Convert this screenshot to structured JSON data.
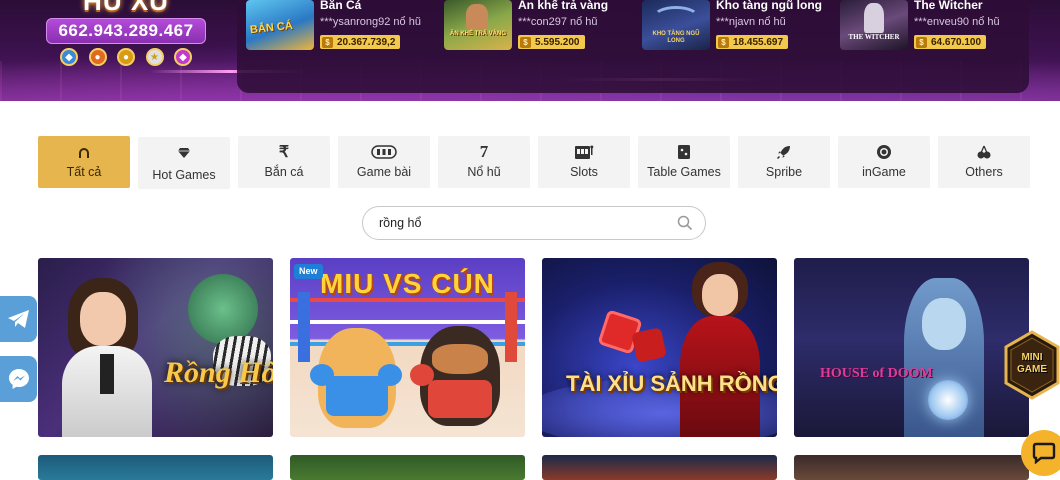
{
  "jackpot": {
    "title": "HŨ XU",
    "amount": "662.943.289.467"
  },
  "winners": [
    {
      "game": "Bắn Cá",
      "user": "***ysanrong92",
      "action": "nổ hũ",
      "amount": "20.367.739,2",
      "thumb_text": "BẮN CÁ"
    },
    {
      "game": "Ăn khế trả vàng",
      "user": "***con297",
      "action": "nổ hũ",
      "amount": "5.595.200",
      "thumb_text": "ĂN KHẾ TRẢ VÀNG"
    },
    {
      "game": "Kho tàng ngũ long",
      "user": "***njavn",
      "action": "nổ hũ",
      "amount": "18.455.697",
      "thumb_text": "KHO TÀNG NGŨ LONG"
    },
    {
      "game": "The Witcher",
      "user": "***enveu90",
      "action": "nổ hũ",
      "amount": "64.670.100",
      "thumb_text": "THE WITCHER"
    }
  ],
  "tabs": [
    {
      "label": "Tất cả",
      "icon": "horseshoe-icon",
      "active": true
    },
    {
      "label": "Hot Games",
      "icon": "diamond-icon",
      "active": false
    },
    {
      "label": "Bắn cá",
      "icon": "rupee-icon",
      "active": false
    },
    {
      "label": "Game bài",
      "icon": "cards-icon",
      "active": false
    },
    {
      "label": "Nổ hũ",
      "icon": "seven-icon",
      "active": false
    },
    {
      "label": "Slots",
      "icon": "slot-machine-icon",
      "active": false
    },
    {
      "label": "Table Games",
      "icon": "dice-icon",
      "active": false
    },
    {
      "label": "Spribe",
      "icon": "rocket-icon",
      "active": false
    },
    {
      "label": "inGame",
      "icon": "chip-icon",
      "active": false
    },
    {
      "label": "Others",
      "icon": "cherries-icon",
      "active": false
    }
  ],
  "search": {
    "value": "rồng hổ",
    "placeholder": ""
  },
  "games": [
    {
      "title": "Rồng Hổ",
      "badge": ""
    },
    {
      "title": "MIU VS CÚN",
      "badge": "New"
    },
    {
      "title": "TÀI XỈU SẢNH RỒNG",
      "badge": ""
    },
    {
      "title": "HOUSE of DOOM",
      "badge": ""
    }
  ],
  "floating": {
    "mini_game_label": "MINI GAME"
  },
  "colors": {
    "accent": "#e6b54e",
    "tab_bg": "#f3f3f3",
    "banner_bg": "#3e1250",
    "amount_badge": "#f3c94d",
    "chat_button": "#f4b32b"
  }
}
